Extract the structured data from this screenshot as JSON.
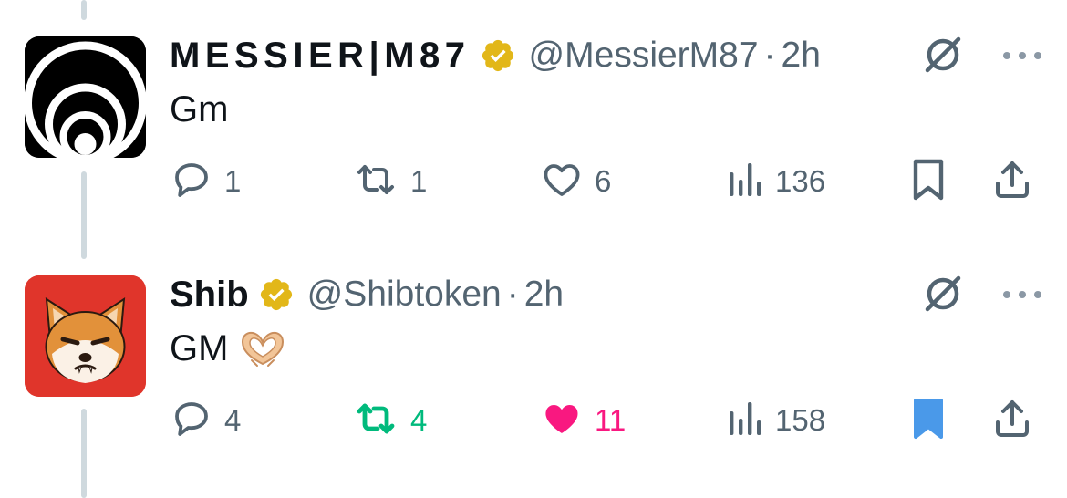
{
  "tweets": [
    {
      "display_name": "MESSIER|M87",
      "handle": "@MessierM87",
      "separator": "·",
      "time": "2h",
      "text": "Gm",
      "emoji": "",
      "counts": {
        "replies": "1",
        "retweets": "1",
        "likes": "6",
        "views": "136"
      },
      "state": {
        "retweeted": false,
        "liked": false,
        "bookmarked": false
      }
    },
    {
      "display_name": "Shib",
      "handle": "@Shibtoken",
      "separator": "·",
      "time": "2h",
      "text": "GM",
      "emoji": "🫶",
      "counts": {
        "replies": "4",
        "retweets": "4",
        "likes": "11",
        "views": "158"
      },
      "state": {
        "retweeted": true,
        "liked": true,
        "bookmarked": true
      }
    }
  ],
  "colors": {
    "gray": "#536471",
    "verified_gold": "#e2b719",
    "retweet_green": "#00ba7c",
    "like_pink": "#f91880",
    "bookmark_blue": "#4a99e9",
    "shib_red": "#e0352b"
  },
  "icons": [
    "grok-icon",
    "more-icon",
    "reply-icon",
    "retweet-icon",
    "like-icon",
    "views-icon",
    "bookmark-icon",
    "share-icon",
    "verified-badge-icon"
  ]
}
